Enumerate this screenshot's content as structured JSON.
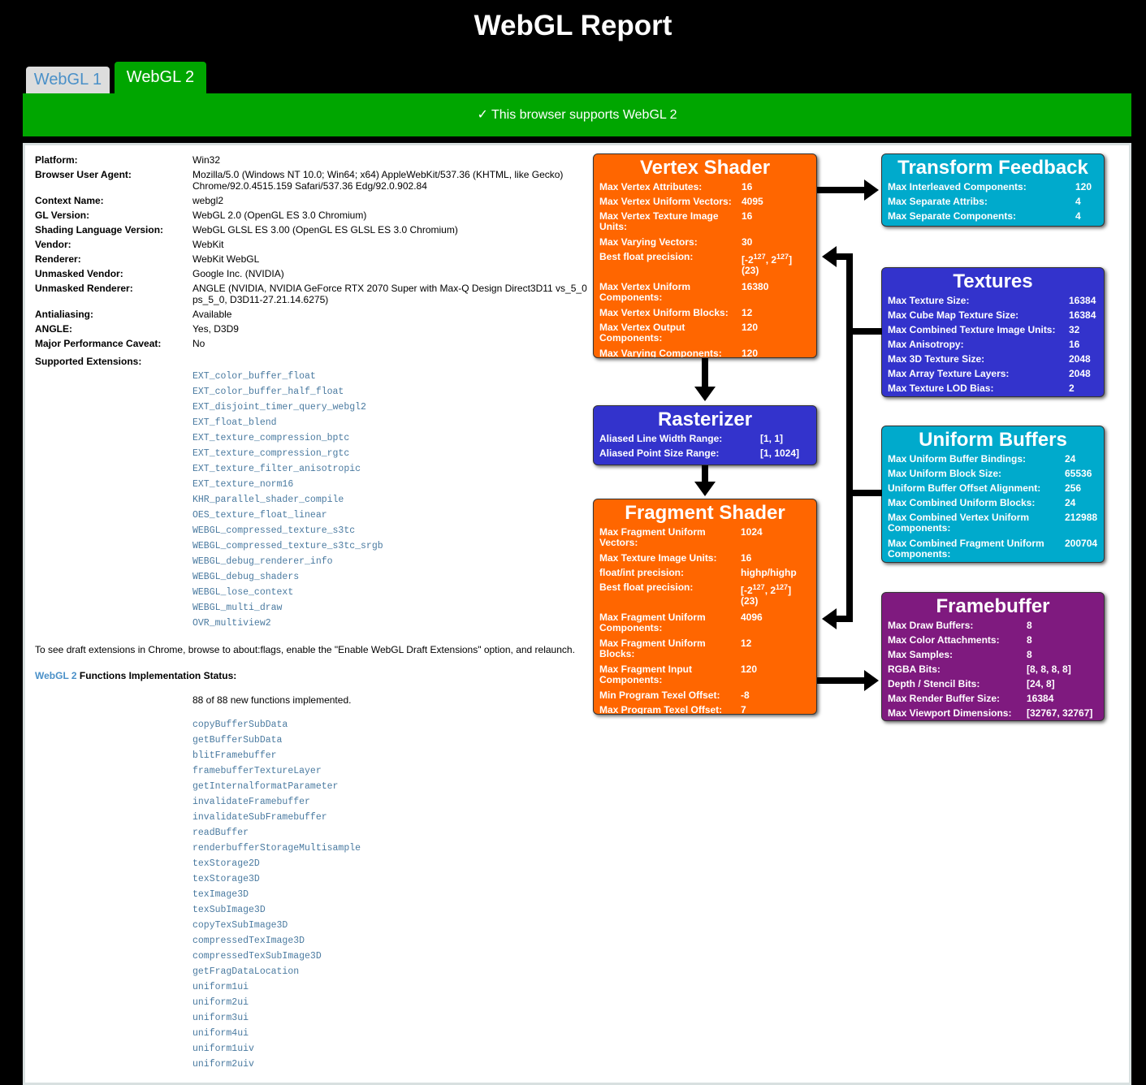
{
  "title": "WebGL Report",
  "tabs": [
    {
      "label": "WebGL 1"
    },
    {
      "label": "WebGL 2"
    }
  ],
  "support_message": "✓ This browser supports WebGL 2",
  "info": [
    {
      "label": "Platform:",
      "value": "Win32"
    },
    {
      "label": "Browser User Agent:",
      "value": "Mozilla/5.0 (Windows NT 10.0; Win64; x64) AppleWebKit/537.36 (KHTML, like Gecko) Chrome/92.0.4515.159 Safari/537.36 Edg/92.0.902.84"
    },
    {
      "label": "Context Name:",
      "value": "webgl2"
    },
    {
      "label": "GL Version:",
      "value": "WebGL 2.0 (OpenGL ES 3.0 Chromium)"
    },
    {
      "label": "Shading Language Version:",
      "value": "WebGL GLSL ES 3.00 (OpenGL ES GLSL ES 3.0 Chromium)"
    },
    {
      "label": "Vendor:",
      "value": "WebKit"
    },
    {
      "label": "Renderer:",
      "value": "WebKit WebGL"
    },
    {
      "label": "Unmasked Vendor:",
      "value": "Google Inc. (NVIDIA)"
    },
    {
      "label": "Unmasked Renderer:",
      "value": "ANGLE (NVIDIA, NVIDIA GeForce RTX 2070 Super with Max-Q Design Direct3D11 vs_5_0 ps_5_0, D3D11-27.21.14.6275)"
    },
    {
      "label": "Antialiasing:",
      "value": "Available"
    },
    {
      "label": "ANGLE:",
      "value": "Yes, D3D9"
    },
    {
      "label": "Major Performance Caveat:",
      "value": "No"
    },
    {
      "label": "Supported Extensions:",
      "value": ""
    }
  ],
  "extensions": [
    "EXT_color_buffer_float",
    "EXT_color_buffer_half_float",
    "EXT_disjoint_timer_query_webgl2",
    "EXT_float_blend",
    "EXT_texture_compression_bptc",
    "EXT_texture_compression_rgtc",
    "EXT_texture_filter_anisotropic",
    "EXT_texture_norm16",
    "KHR_parallel_shader_compile",
    "OES_texture_float_linear",
    "WEBGL_compressed_texture_s3tc",
    "WEBGL_compressed_texture_s3tc_srgb",
    "WEBGL_debug_renderer_info",
    "WEBGL_debug_shaders",
    "WEBGL_lose_context",
    "WEBGL_multi_draw",
    "OVR_multiview2"
  ],
  "draft_note": "To see draft extensions in Chrome, browse to about:flags, enable the \"Enable WebGL Draft Extensions\" option, and relaunch.",
  "functions_heading": {
    "link": "WebGL 2",
    "text": " Functions Implementation Status:"
  },
  "functions_count": "88 of 88 new functions implemented.",
  "functions": [
    "copyBufferSubData",
    "getBufferSubData",
    "blitFramebuffer",
    "framebufferTextureLayer",
    "getInternalformatParameter",
    "invalidateFramebuffer",
    "invalidateSubFramebuffer",
    "readBuffer",
    "renderbufferStorageMultisample",
    "texStorage2D",
    "texStorage3D",
    "texImage3D",
    "texSubImage3D",
    "copyTexSubImage3D",
    "compressedTexImage3D",
    "compressedTexSubImage3D",
    "getFragDataLocation",
    "uniform1ui",
    "uniform2ui",
    "uniform3ui",
    "uniform4ui",
    "uniform1uiv",
    "uniform2uiv"
  ],
  "colors": {
    "orange": "#ff6600",
    "blue": "#3333cc",
    "cyan": "#00aacc",
    "purple": "#7f1a7f",
    "green": "#00a600"
  },
  "vertex": {
    "title": "Vertex Shader",
    "rows": [
      {
        "k": "Max Vertex Attributes:",
        "v": "16"
      },
      {
        "k": "Max Vertex Uniform Vectors:",
        "v": "4095"
      },
      {
        "k": "Max Vertex Texture Image Units:",
        "v": "16"
      },
      {
        "k": "Max Varying Vectors:",
        "v": "30"
      },
      {
        "k": "Best float precision:",
        "v": "[-2^127, 2^127] (23)"
      },
      {
        "k": "Max Vertex Uniform Components:",
        "v": "16380"
      },
      {
        "k": "Max Vertex Uniform Blocks:",
        "v": "12"
      },
      {
        "k": "Max Vertex Output Components:",
        "v": "120"
      },
      {
        "k": "Max Varying Components:",
        "v": "120"
      }
    ]
  },
  "rasterizer": {
    "title": "Rasterizer",
    "rows": [
      {
        "k": "Aliased Line Width Range:",
        "v": "[1, 1]"
      },
      {
        "k": "Aliased Point Size Range:",
        "v": "[1, 1024]"
      }
    ]
  },
  "fragment": {
    "title": "Fragment Shader",
    "rows": [
      {
        "k": "Max Fragment Uniform Vectors:",
        "v": "1024"
      },
      {
        "k": "Max Texture Image Units:",
        "v": "16"
      },
      {
        "k": "float/int precision:",
        "v": "highp/highp"
      },
      {
        "k": "Best float precision:",
        "v": "[-2^127, 2^127] (23)"
      },
      {
        "k": "Max Fragment Uniform Components:",
        "v": "4096"
      },
      {
        "k": "Max Fragment Uniform Blocks:",
        "v": "12"
      },
      {
        "k": "Max Fragment Input Components:",
        "v": "120"
      },
      {
        "k": "Min Program Texel Offset:",
        "v": "-8"
      },
      {
        "k": "Max Program Texel Offset:",
        "v": "7"
      }
    ]
  },
  "transform": {
    "title": "Transform Feedback",
    "rows": [
      {
        "k": "Max Interleaved Components:",
        "v": "120"
      },
      {
        "k": "Max Separate Attribs:",
        "v": "4"
      },
      {
        "k": "Max Separate Components:",
        "v": "4"
      }
    ]
  },
  "textures": {
    "title": "Textures",
    "rows": [
      {
        "k": "Max Texture Size:",
        "v": "16384"
      },
      {
        "k": "Max Cube Map Texture Size:",
        "v": "16384"
      },
      {
        "k": "Max Combined Texture Image Units:",
        "v": "32"
      },
      {
        "k": "Max Anisotropy:",
        "v": "16"
      },
      {
        "k": "Max 3D Texture Size:",
        "v": "2048"
      },
      {
        "k": "Max Array Texture Layers:",
        "v": "2048"
      },
      {
        "k": "Max Texture LOD Bias:",
        "v": "2"
      }
    ]
  },
  "uniform": {
    "title": "Uniform Buffers",
    "rows": [
      {
        "k": "Max Uniform Buffer Bindings:",
        "v": "24"
      },
      {
        "k": "Max Uniform Block Size:",
        "v": "65536"
      },
      {
        "k": "Uniform Buffer Offset Alignment:",
        "v": "256"
      },
      {
        "k": "Max Combined Uniform Blocks:",
        "v": "24"
      },
      {
        "k": "Max Combined Vertex Uniform Components:",
        "v": "212988"
      },
      {
        "k": "Max Combined Fragment Uniform Components:",
        "v": "200704"
      }
    ]
  },
  "framebuffer": {
    "title": "Framebuffer",
    "rows": [
      {
        "k": "Max Draw Buffers:",
        "v": "8"
      },
      {
        "k": "Max Color Attachments:",
        "v": "8"
      },
      {
        "k": "Max Samples:",
        "v": "8"
      },
      {
        "k": "RGBA Bits:",
        "v": "[8, 8, 8, 8]"
      },
      {
        "k": "Depth / Stencil Bits:",
        "v": "[24, 8]"
      },
      {
        "k": "Max Render Buffer Size:",
        "v": "16384"
      },
      {
        "k": "Max Viewport Dimensions:",
        "v": "[32767, 32767]"
      }
    ]
  }
}
